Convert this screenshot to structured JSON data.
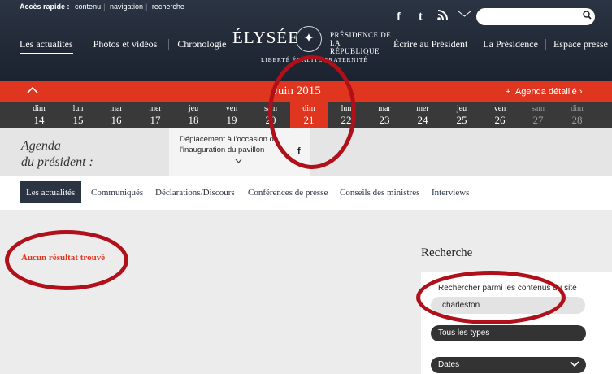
{
  "header": {
    "quick_access_label": "Accès rapide :",
    "quick_links": [
      "contenu",
      "navigation",
      "recherche"
    ],
    "social_icons": [
      "facebook-icon",
      "twitter-icon",
      "rss-icon",
      "mail-icon"
    ],
    "search_placeholder": "",
    "nav_left": [
      "Les actualités",
      "Photos et vidéos",
      "Chronologie"
    ],
    "nav_right": [
      "Écrire au Président",
      "La Présidence",
      "Espace presse"
    ],
    "logo": {
      "brand": "ÉLYSÉE",
      "presidence_line1": "PRÉSIDENCE DE",
      "presidence_line2": "LA RÉPUBLIQUE",
      "motto": "LIBERTÉ ÉGALITÉ FRATERNITÉ"
    }
  },
  "calendar": {
    "month": "Juin 2015",
    "agenda_link": "Agenda détaillé",
    "days": [
      {
        "name": "dim",
        "num": "14"
      },
      {
        "name": "lun",
        "num": "15"
      },
      {
        "name": "mar",
        "num": "16"
      },
      {
        "name": "mer",
        "num": "17"
      },
      {
        "name": "jeu",
        "num": "18"
      },
      {
        "name": "ven",
        "num": "19"
      },
      {
        "name": "sam",
        "num": "20"
      },
      {
        "name": "dim",
        "num": "21"
      },
      {
        "name": "lun",
        "num": "22"
      },
      {
        "name": "mar",
        "num": "23"
      },
      {
        "name": "mer",
        "num": "24"
      },
      {
        "name": "jeu",
        "num": "25"
      },
      {
        "name": "ven",
        "num": "26"
      },
      {
        "name": "sam",
        "num": "27"
      },
      {
        "name": "dim",
        "num": "28"
      }
    ],
    "selected_index": 7
  },
  "agenda": {
    "title_line1": "Agenda",
    "title_line2": "du président :",
    "event_text": "Déplacement à l'occasion de l'inauguration du pavillon",
    "share_letter": "f"
  },
  "tabs": [
    "Les actualités",
    "Communiqués",
    "Déclarations/Discours",
    "Conférences de presse",
    "Conseils des ministres",
    "Interviews"
  ],
  "content": {
    "no_result": "Aucun résultat trouvé"
  },
  "sidebar": {
    "title": "Recherche",
    "search_label": "Rechercher parmi les contenus du site",
    "search_value": "charleston",
    "type_select": "Tous les types",
    "dates_select": "Dates"
  },
  "colors": {
    "header_bg": "#1b2230",
    "accent_red": "#e0351e",
    "days_bg": "#393939",
    "annotation": "#b0101a"
  }
}
